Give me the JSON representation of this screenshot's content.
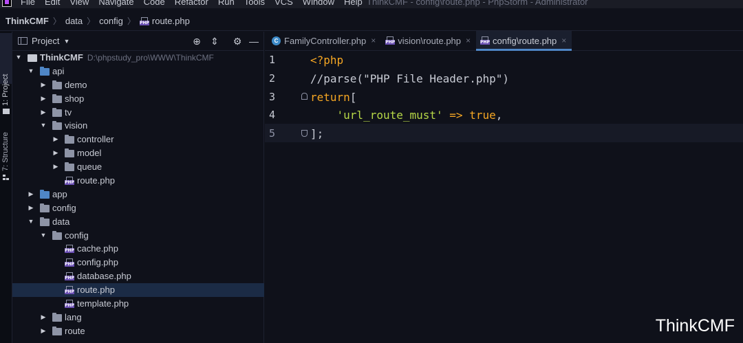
{
  "menubar": {
    "items": [
      "File",
      "Edit",
      "View",
      "Navigate",
      "Code",
      "Refactor",
      "Run",
      "Tools",
      "VCS",
      "Window",
      "Help"
    ],
    "window_title": "ThinkCMF - config\\route.php - PhpStorm - Administrator"
  },
  "navbar": {
    "crumbs": [
      "ThinkCMF",
      "data",
      "config",
      "route.php"
    ]
  },
  "toolstrip": {
    "project_label": "1: Project",
    "structure_label": "7: Structure"
  },
  "project_panel": {
    "title": "Project",
    "root_name": "ThinkCMF",
    "root_path": "D:\\phpstudy_pro\\WWW\\ThinkCMF",
    "tree": [
      {
        "depth": 0,
        "type": "root",
        "expanded": true,
        "name": "ThinkCMF"
      },
      {
        "depth": 1,
        "type": "folder",
        "expanded": true,
        "color": "blue",
        "name": "api"
      },
      {
        "depth": 2,
        "type": "folder",
        "expanded": false,
        "color": "gray",
        "name": "demo"
      },
      {
        "depth": 2,
        "type": "folder",
        "expanded": false,
        "color": "gray",
        "name": "shop"
      },
      {
        "depth": 2,
        "type": "folder",
        "expanded": false,
        "color": "gray",
        "name": "tv"
      },
      {
        "depth": 2,
        "type": "folder",
        "expanded": true,
        "color": "gray",
        "name": "vision"
      },
      {
        "depth": 3,
        "type": "folder",
        "expanded": false,
        "color": "gray",
        "name": "controller"
      },
      {
        "depth": 3,
        "type": "folder",
        "expanded": false,
        "color": "gray",
        "name": "model"
      },
      {
        "depth": 3,
        "type": "folder",
        "expanded": false,
        "color": "gray",
        "name": "queue"
      },
      {
        "depth": 3,
        "type": "php",
        "name": "route.php"
      },
      {
        "depth": 1,
        "type": "folder",
        "expanded": false,
        "color": "blue",
        "name": "app"
      },
      {
        "depth": 1,
        "type": "folder",
        "expanded": false,
        "color": "gray",
        "name": "config"
      },
      {
        "depth": 1,
        "type": "folder",
        "expanded": true,
        "color": "gray",
        "name": "data"
      },
      {
        "depth": 2,
        "type": "folder",
        "expanded": true,
        "color": "gray",
        "name": "config"
      },
      {
        "depth": 3,
        "type": "php",
        "name": "cache.php"
      },
      {
        "depth": 3,
        "type": "php",
        "name": "config.php"
      },
      {
        "depth": 3,
        "type": "php",
        "name": "database.php"
      },
      {
        "depth": 3,
        "type": "php",
        "name": "route.php",
        "selected": true
      },
      {
        "depth": 3,
        "type": "php",
        "name": "template.php"
      },
      {
        "depth": 2,
        "type": "folder",
        "expanded": false,
        "color": "gray",
        "name": "lang"
      },
      {
        "depth": 2,
        "type": "folder",
        "expanded": false,
        "color": "gray",
        "name": "route"
      }
    ]
  },
  "tabs": [
    {
      "label": "FamilyController.php",
      "icon": "class-icon",
      "active": false
    },
    {
      "label": "vision\\route.php",
      "icon": "php-file-icon",
      "active": false
    },
    {
      "label": "config\\route.php",
      "icon": "php-file-icon",
      "active": true
    }
  ],
  "editor": {
    "line_numbers": [
      "1",
      "2",
      "3",
      "4",
      "5"
    ],
    "lines": [
      [
        {
          "t": "<?php",
          "c": "kw"
        }
      ],
      [
        {
          "t": "//parse(\"PHP File Header.php\")",
          "c": "cm"
        }
      ],
      [
        {
          "t": "return",
          "c": "kw"
        },
        {
          "t": "[",
          "c": "pl"
        }
      ],
      [
        {
          "t": "    ",
          "c": "pl"
        },
        {
          "t": "'url_route_must'",
          "c": "st"
        },
        {
          "t": " => ",
          "c": "op"
        },
        {
          "t": "true",
          "c": "kw"
        },
        {
          "t": ",",
          "c": "pl"
        }
      ],
      [
        {
          "t": "];",
          "c": "pl"
        }
      ]
    ],
    "current_line": 5
  },
  "watermark": "ThinkCMF",
  "colors": {
    "background": "#0f111a",
    "keyword": "#f5a623",
    "string": "#b7d847",
    "selection": "#1b2b45",
    "accent": "#4f86c6"
  }
}
